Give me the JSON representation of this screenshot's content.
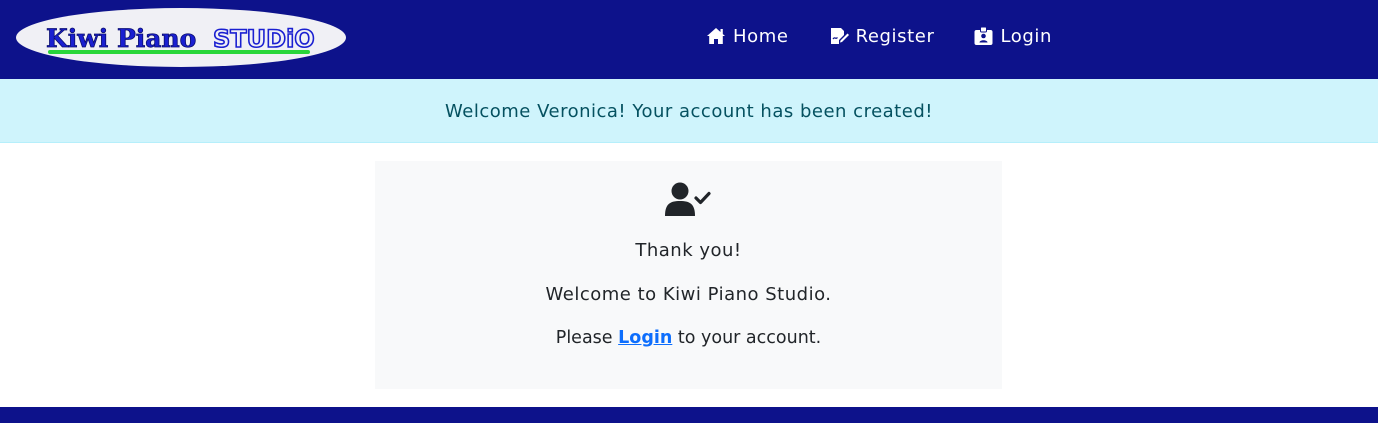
{
  "brand": {
    "logo_text_main": "Kiwi Piano",
    "logo_text_studio": "STUDiO",
    "logo_icon": "kiwi-piano-studio-logo",
    "colors": {
      "navbar": "#0d128b",
      "logo_text": "#1a1fd1",
      "logo_underline": "#29d63a"
    }
  },
  "nav": {
    "items": [
      {
        "label": "Home",
        "icon": "home-icon"
      },
      {
        "label": "Register",
        "icon": "register-icon"
      },
      {
        "label": "Login",
        "icon": "login-badge-icon"
      }
    ]
  },
  "alert": {
    "message": "Welcome Veronica! Your account has been created!",
    "colors": {
      "background": "#cff4fc",
      "text": "#055160"
    }
  },
  "card": {
    "icon": "user-check-icon",
    "thanks": "Thank you!",
    "welcome": "Welcome to Kiwi Piano Studio.",
    "login_prefix": "Please",
    "login_link": "Login",
    "login_suffix": "to your account.",
    "colors": {
      "background": "#f8f9fa",
      "link": "#0d6efd"
    }
  }
}
